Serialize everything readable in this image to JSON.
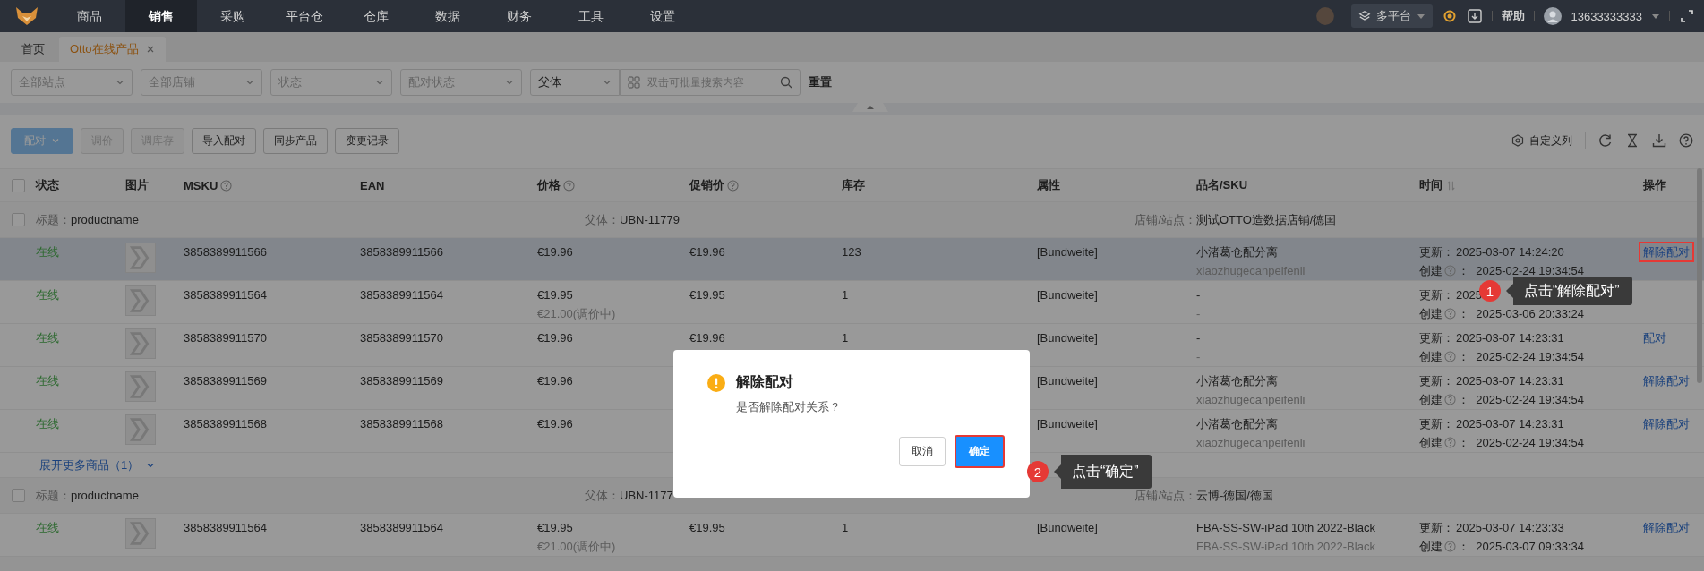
{
  "nav": {
    "items": [
      {
        "label": "商品",
        "selected": false
      },
      {
        "label": "销售",
        "selected": true
      },
      {
        "label": "采购",
        "selected": false
      },
      {
        "label": "平台仓",
        "selected": false
      },
      {
        "label": "仓库",
        "selected": false
      },
      {
        "label": "数据",
        "selected": false
      },
      {
        "label": "财务",
        "selected": false
      },
      {
        "label": "工具",
        "selected": false
      },
      {
        "label": "设置",
        "selected": false
      }
    ],
    "platform": "多平台",
    "help": "帮助",
    "user": "13633333333"
  },
  "tabs": [
    {
      "label": "首页",
      "selected": false,
      "closable": false
    },
    {
      "label": "Otto在线产品",
      "selected": true,
      "closable": true
    }
  ],
  "filters": [
    {
      "placeholder": "全部站点"
    },
    {
      "placeholder": "全部店铺"
    },
    {
      "placeholder": "状态"
    },
    {
      "placeholder": "配对状态"
    }
  ],
  "search": {
    "scope": "父体",
    "placeholder": "双击可批量搜索内容"
  },
  "reset": "重置",
  "toolbar": {
    "buttons": [
      {
        "label": "配对",
        "kind": "primary",
        "disabled": true,
        "dropdown": true
      },
      {
        "label": "调价",
        "kind": "default",
        "disabled": true,
        "dropdown": false
      },
      {
        "label": "调库存",
        "kind": "default",
        "disabled": true,
        "dropdown": false
      },
      {
        "label": "导入配对",
        "kind": "default",
        "disabled": false,
        "dropdown": false
      },
      {
        "label": "同步产品",
        "kind": "default",
        "disabled": false,
        "dropdown": false
      },
      {
        "label": "变更记录",
        "kind": "default",
        "disabled": false,
        "dropdown": false
      }
    ],
    "custom_columns": "自定义列"
  },
  "table": {
    "all_checked": false,
    "columns": [
      {
        "label": "状态",
        "kind": "plain"
      },
      {
        "label": "图片",
        "kind": "plain"
      },
      {
        "label": "MSKU",
        "kind": "help"
      },
      {
        "label": "EAN",
        "kind": "plain"
      },
      {
        "label": "价格",
        "kind": "help"
      },
      {
        "label": "促销价",
        "kind": "help"
      },
      {
        "label": "库存",
        "kind": "plain"
      },
      {
        "label": "属性",
        "kind": "plain"
      },
      {
        "label": "品名/SKU",
        "kind": "plain"
      },
      {
        "label": "时间",
        "kind": "sort"
      },
      {
        "label": "操作",
        "kind": "plain"
      }
    ],
    "groups": [
      {
        "checked": false,
        "title_label": "标题：",
        "title": "productname",
        "parent_label": "父体：",
        "parent": "UBN-11779",
        "store_label": "店铺/站点：",
        "store": "测试OTTO造数据店铺/德国",
        "more": "展开更多商品（1）",
        "rows": [
          {
            "status": "在线",
            "msku": "3858389911566",
            "ean": "3858389911566",
            "price": "€19.96",
            "promo": "€19.96",
            "stock": "123",
            "attr": "[Bundweite]",
            "name": "小渚葛仓配分离",
            "sku": "xiaozhugecanpeifenli",
            "updated_label": "更新：",
            "updated": "2025-03-07 14:24:20",
            "created_label": "创建",
            "created": "：  2025-02-24 19:34:54",
            "action": "解除配对",
            "selected": true,
            "outlined": true
          },
          {
            "status": "在线",
            "msku": "3858389911564",
            "ean": "3858389911564",
            "price": "€19.95",
            "price_note": "€21.00(调价中)",
            "promo": "€19.95",
            "stock": "1",
            "attr": "[Bundweite]",
            "name": "-",
            "sku": "-",
            "updated_label": "更新：",
            "updated": "2025",
            "created_label": "创建",
            "created": "：  2025-03-06 20:33:24",
            "selected": false
          },
          {
            "status": "在线",
            "msku": "3858389911570",
            "ean": "3858389911570",
            "price": "€19.96",
            "promo": "€19.96",
            "stock": "1",
            "attr": "[Bundweite]",
            "name": "-",
            "sku": "-",
            "updated_label": "更新：",
            "updated": "2025-03-07 14:23:31",
            "created_label": "创建",
            "created": "：  2025-02-24 19:34:54",
            "action": "配对",
            "selected": false,
            "outlined": false
          },
          {
            "status": "在线",
            "msku": "3858389911569",
            "ean": "3858389911569",
            "price": "€19.96",
            "attr": "[Bundweite]",
            "name": "小渚葛仓配分离",
            "sku": "xiaozhugecanpeifenli",
            "updated_label": "更新：",
            "updated": "2025-03-07 14:23:31",
            "created_label": "创建",
            "created": "：  2025-02-24 19:34:54",
            "action": "解除配对",
            "selected": false,
            "outlined": false
          },
          {
            "status": "在线",
            "msku": "3858389911568",
            "ean": "3858389911568",
            "price": "€19.96",
            "attr": "[Bundweite]",
            "name": "小渚葛仓配分离",
            "sku": "xiaozhugecanpeifenli",
            "updated_label": "更新：",
            "updated": "2025-03-07 14:23:31",
            "created_label": "创建",
            "created": "：  2025-02-24 19:34:54",
            "action": "解除配对",
            "selected": false,
            "outlined": false
          }
        ]
      },
      {
        "checked": false,
        "title_label": "标题：",
        "title": "productname",
        "parent_label": "父体：",
        "parent": "UBN-1177",
        "store_label": "店铺/站点：",
        "store": "云博-德国/德国",
        "rows": [
          {
            "status": "在线",
            "msku": "3858389911564",
            "ean": "3858389911564",
            "price": "€19.95",
            "price_note": "€21.00(调价中)",
            "promo": "€19.95",
            "stock": "1",
            "attr": "[Bundweite]",
            "name": "FBA-SS-SW-iPad 10th 2022-Black",
            "sku": "FBA-SS-SW-iPad 10th 2022-Black",
            "updated_label": "更新：",
            "updated": "2025-03-07 14:23:33",
            "created_label": "创建",
            "created": "：  2025-03-07 09:33:34",
            "action": "解除配对",
            "selected": false,
            "outlined": false
          }
        ]
      }
    ]
  },
  "dialog": {
    "title": "解除配对",
    "message": "是否解除配对关系？",
    "cancel": "取消",
    "confirm": "确定",
    "confirm_outlined": true
  },
  "callouts": [
    {
      "number": "1",
      "text": "点击“解除配对”"
    },
    {
      "number": "2",
      "text": "点击“确定”"
    }
  ]
}
